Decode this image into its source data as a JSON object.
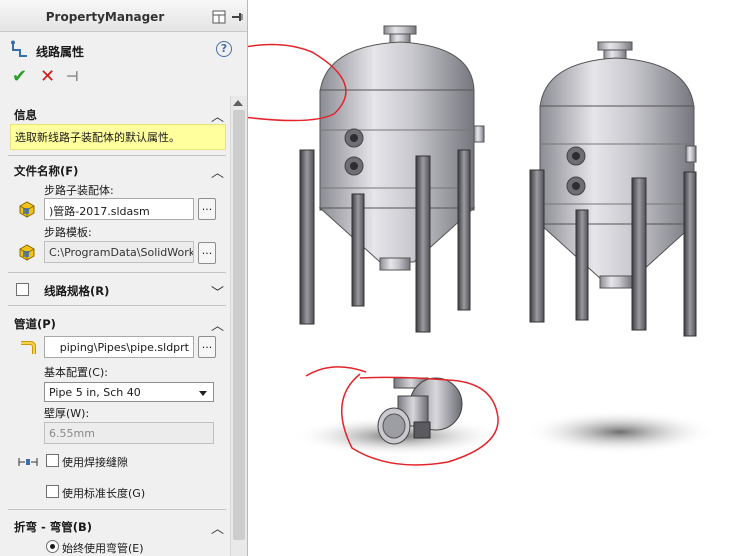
{
  "header": {
    "title": "PropertyManager"
  },
  "feature": {
    "title": "线路属性",
    "help": "?"
  },
  "actions": {
    "ok": "✔",
    "cancel": "✕",
    "pin": "⊣"
  },
  "sections": {
    "info": {
      "title": "信息",
      "message": "选取新线路子装配体的默认属性。"
    },
    "file_name": {
      "title": "文件名称(F)",
      "assembly_label": "步路子装配体:",
      "assembly_value": ")管路-2017.sldasm",
      "template_label": "步路模板:",
      "template_value": "C:\\ProgramData\\SolidWorks",
      "browse": "..."
    },
    "route_spec": {
      "title": "线路规格(R)"
    },
    "pipe": {
      "title": "管道(P)",
      "pipe_path": "piping\\Pipes\\pipe.sldprt",
      "browse": "...",
      "base_config_label": "基本配置(C):",
      "base_config_value": "Pipe 5 in, Sch 40",
      "wall_label": "壁厚(W):",
      "wall_value": "6.55mm",
      "use_weld_gap": "使用焊接缝隙",
      "use_std_length": "使用标准长度(G)"
    },
    "bends": {
      "title": "折弯 - 弯管(B)",
      "always_use_elbow": "始终使用弯管(E)"
    }
  },
  "icons": {
    "chevron_up": "︿",
    "chevron_down": "﹀"
  },
  "colors": {
    "panel_bg": "#f0f0f0",
    "info_bg": "#ffff9e",
    "ok": "#2e9e2e",
    "cancel": "#d11a1a",
    "annotation": "#e3242b"
  }
}
